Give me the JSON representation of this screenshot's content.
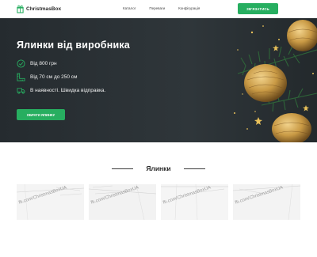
{
  "header": {
    "logo_text": "ChristmasBox",
    "logo_icon": "gift-icon",
    "nav": [
      "Каталог",
      "Переваги",
      "Конфігурація"
    ],
    "cta_label": "ЗВ'ЯЗАТИСЬ"
  },
  "hero": {
    "title": "Ялинки від виробника",
    "features": [
      {
        "icon": "price-tag-icon",
        "text": "Від 800 грн"
      },
      {
        "icon": "ruler-icon",
        "text": "Від 70 см до 250 см"
      },
      {
        "icon": "delivery-icon",
        "text": "В наявності. Швидка відправка."
      }
    ],
    "button_label": "ОБРАТИ ЯЛИНКУ"
  },
  "section": {
    "title": "Ялинки",
    "cards": [
      {
        "watermark": "fb.com/ChristmasBoxUA"
      },
      {
        "watermark": "fb.com/ChristmasBoxUA"
      },
      {
        "watermark": "fb.com/ChristmasBoxUA"
      },
      {
        "watermark": "fb.com/ChristmasBoxUA"
      }
    ]
  },
  "colors": {
    "accent": "#27ae60",
    "hero_bg": "#2c3236",
    "text_dark": "#2b2b2b"
  }
}
